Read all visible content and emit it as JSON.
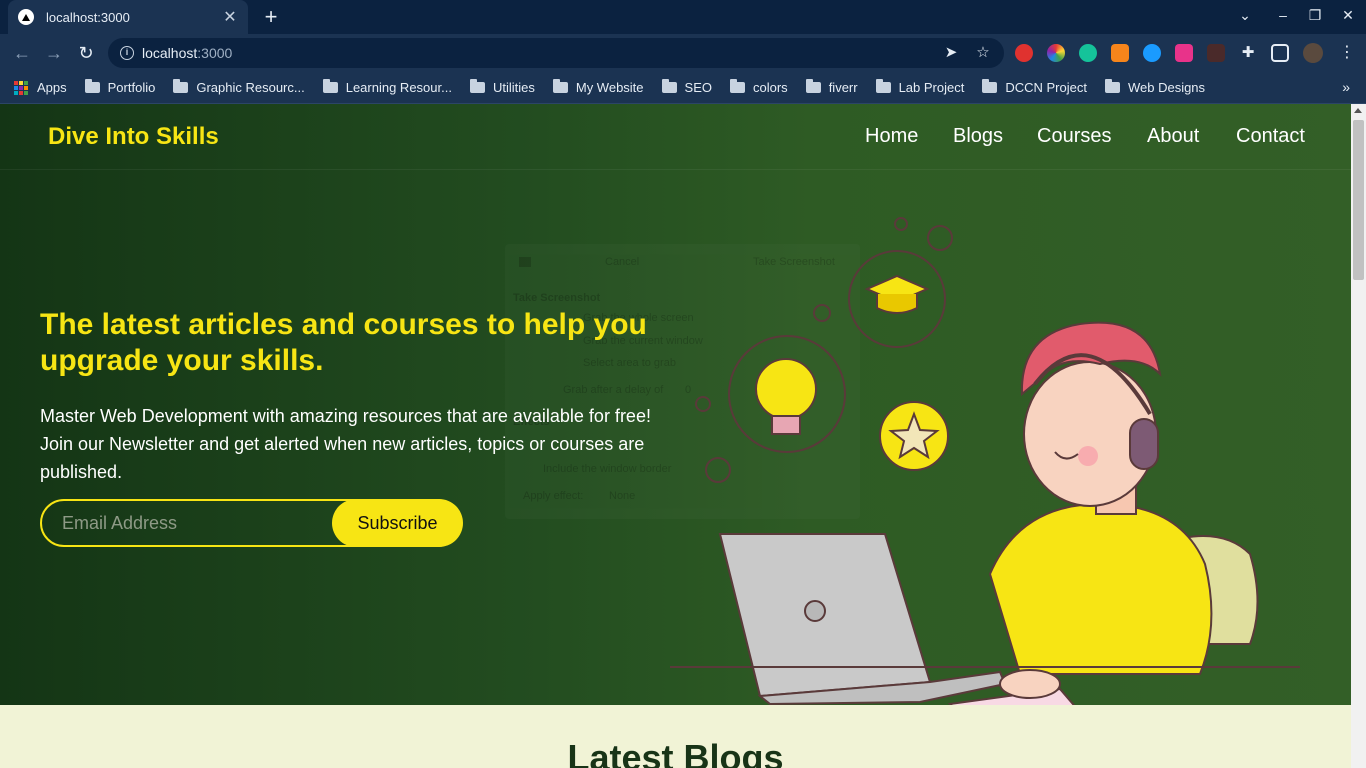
{
  "browser": {
    "tab_title": "localhost:3000",
    "new_tab": "+",
    "tab_close": "✕",
    "url_host": "localhost",
    "url_port": ":3000",
    "bookmarks": [
      "Apps",
      "Portfolio",
      "Graphic Resourc...",
      "Learning Resour...",
      "Utilities",
      "My Website",
      "SEO",
      "colors",
      "fiverr",
      "Lab Project",
      "DCCN Project",
      "Web Designs"
    ],
    "bookmarks_more": "»"
  },
  "site": {
    "logo": "Dive Into Skills",
    "nav": [
      "Home",
      "Blogs",
      "Courses",
      "About",
      "Contact"
    ]
  },
  "hero": {
    "headline": "The latest articles and courses to help you upgrade your skills.",
    "subtext": "Master Web Development with amazing resources that are available for free! Join our Newsletter and get alerted when new articles, topics or courses are published.",
    "email_placeholder": "Email Address",
    "subscribe_label": "Subscribe"
  },
  "overlay_dialog": {
    "cancel": "Cancel",
    "take_screenshot_btn": "Take Screenshot",
    "heading": "Take Screenshot",
    "opt1": "Grab the whole screen",
    "opt2": "Grab the current window",
    "opt3": "Select area to grab",
    "delay": "Grab after a delay of",
    "delay_value": "0",
    "effects": "Effects",
    "border": "Include the window border",
    "apply": "Apply effect:",
    "apply_value": "None"
  },
  "latest": {
    "title": "Latest Blogs"
  },
  "colors": {
    "accent_yellow": "#f7e514",
    "hero_dark": "#143515",
    "hero_light": "#335f27",
    "latest_bg": "#f1f3d6",
    "chrome_bg": "#0b2240"
  }
}
